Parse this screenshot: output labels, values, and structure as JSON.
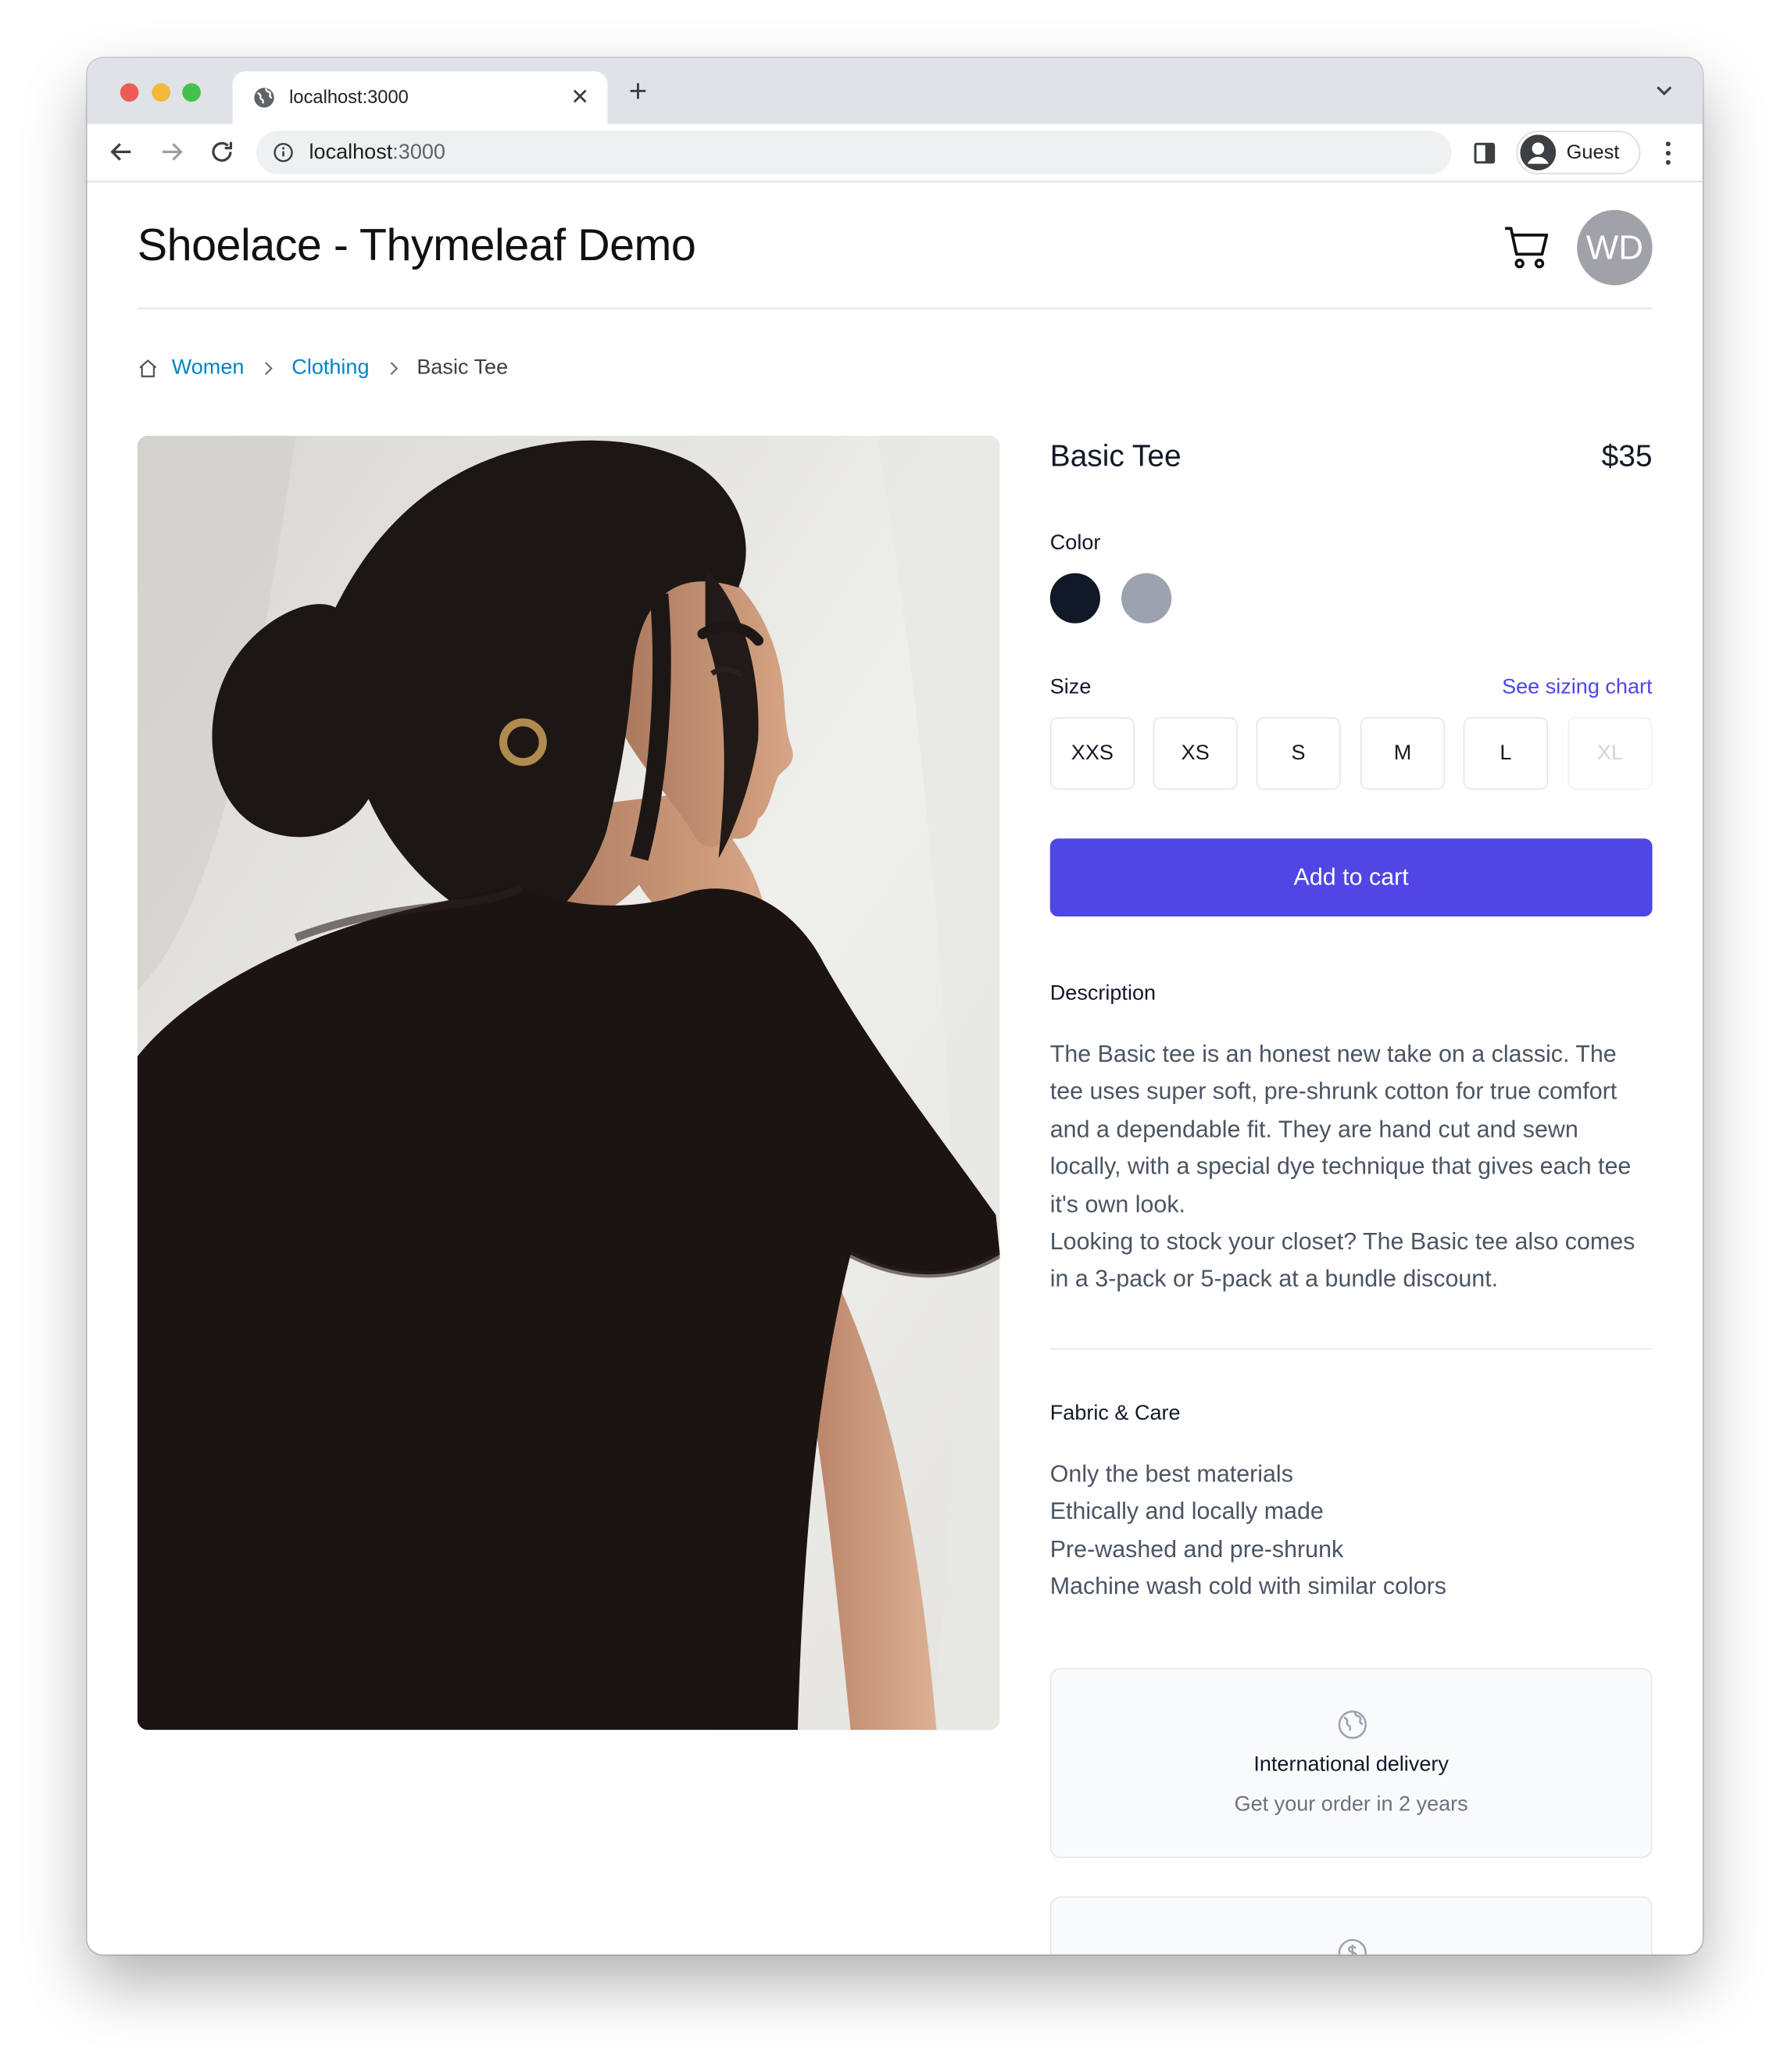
{
  "browser": {
    "tab_title": "localhost:3000",
    "url_host": "localhost",
    "url_port": ":3000",
    "profile_label": "Guest"
  },
  "header": {
    "site_title": "Shoelace - Thymeleaf Demo",
    "avatar_initials": "WD"
  },
  "breadcrumb": {
    "items": [
      "Women",
      "Clothing"
    ],
    "current": "Basic Tee"
  },
  "product": {
    "name": "Basic Tee",
    "price": "$35",
    "color_label": "Color",
    "colors": [
      {
        "name": "Black",
        "hex": "#111827",
        "selected": true
      },
      {
        "name": "Gray",
        "hex": "#9ca3af",
        "selected": false
      }
    ],
    "size_label": "Size",
    "sizing_chart_link": "See sizing chart",
    "sizes": [
      {
        "label": "XXS",
        "available": true
      },
      {
        "label": "XS",
        "available": true
      },
      {
        "label": "S",
        "available": true
      },
      {
        "label": "M",
        "available": true
      },
      {
        "label": "L",
        "available": true
      },
      {
        "label": "XL",
        "available": false
      }
    ],
    "add_to_cart_label": "Add to cart"
  },
  "description": {
    "heading": "Description",
    "paragraphs": [
      "The Basic tee is an honest new take on a classic. The tee uses super soft, pre-shrunk cotton for true comfort and a dependable fit. They are hand cut and sewn locally, with a special dye technique that gives each tee it's own look.",
      "Looking to stock your closet? The Basic tee also comes in a 3-pack or 5-pack at a bundle discount."
    ]
  },
  "fabric_care": {
    "heading": "Fabric & Care",
    "items": [
      "Only the best materials",
      "Ethically and locally made",
      "Pre-washed and pre-shrunk",
      "Machine wash cold with similar colors"
    ]
  },
  "policies": [
    {
      "icon": "globe-icon",
      "title": "International delivery",
      "subtitle": "Get your order in 2 years"
    },
    {
      "icon": "currency-dollar-icon",
      "title": "",
      "subtitle": ""
    }
  ],
  "colors": {
    "accent": "#4f46e5",
    "link": "#0284c7",
    "text_muted": "#4b5563"
  }
}
